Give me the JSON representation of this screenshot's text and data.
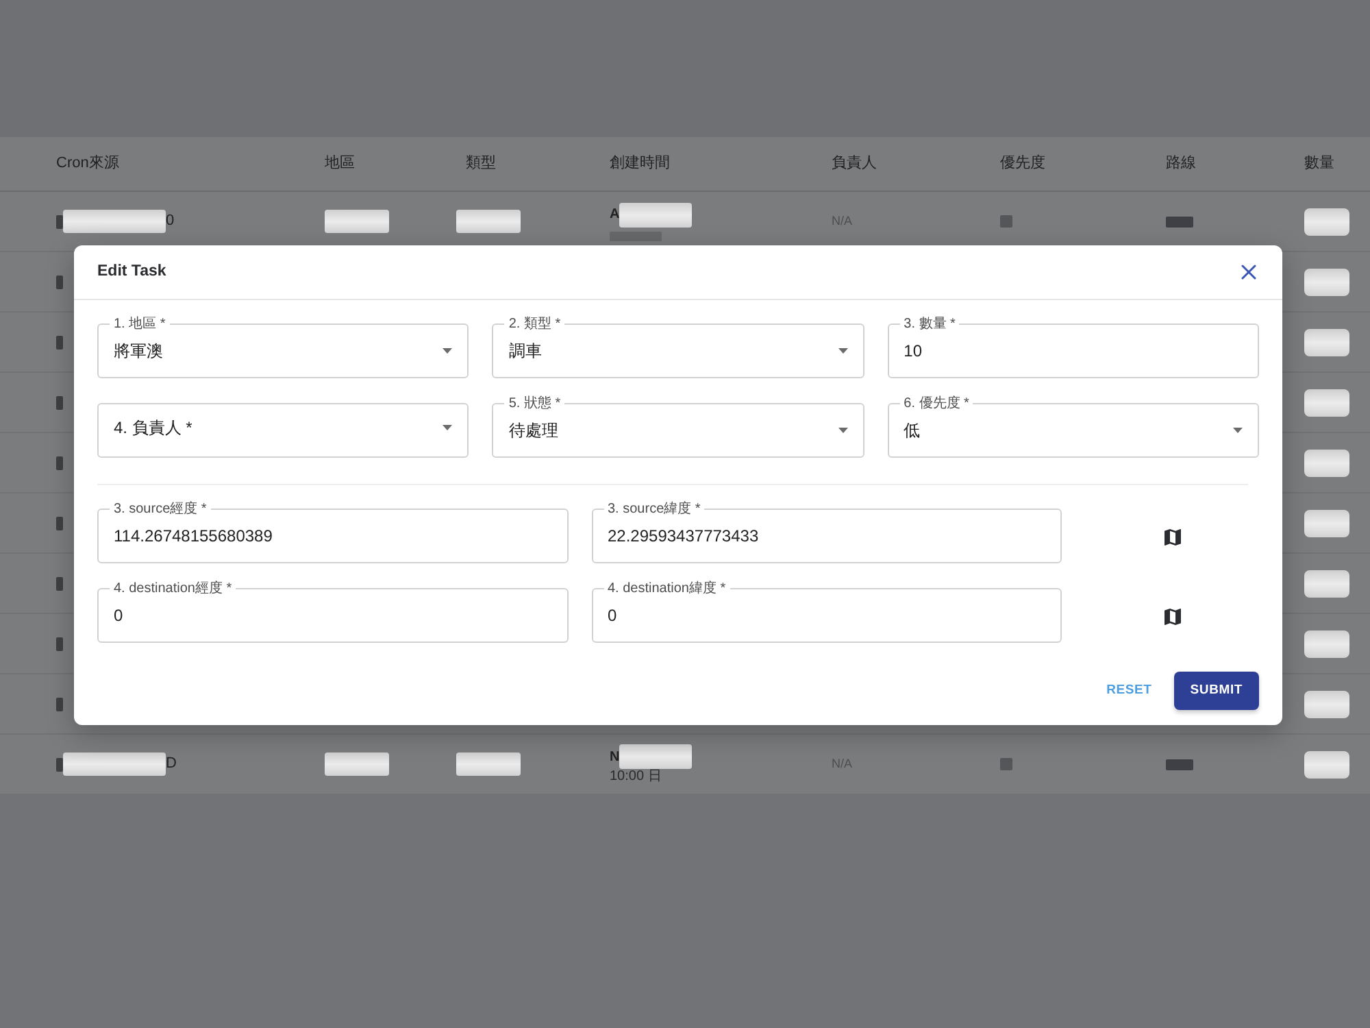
{
  "background_table": {
    "columns": [
      "Cron來源",
      "地區",
      "類型",
      "創建時間",
      "負責人",
      "優先度",
      "路線",
      "數量"
    ],
    "rows": [
      {
        "cron_source": [
          [
            {
              "kind": "blur"
            },
            {
              "kind": "redacted"
            },
            {
              "kind": "text",
              "text": "0"
            }
          ]
        ],
        "region": [
          [
            {
              "kind": "redacted"
            }
          ]
        ],
        "type": [
          [
            {
              "kind": "redacted"
            }
          ]
        ],
        "created_at": [
          [
            {
              "kind": "text",
              "text": "A"
            },
            {
              "kind": "redacted"
            }
          ],
          [
            {
              "kind": "blur"
            }
          ]
        ],
        "owner": [
          [
            {
              "kind": "text",
              "text": "N/A"
            }
          ]
        ],
        "priority": [
          [
            {
              "kind": "blur"
            }
          ]
        ],
        "route": [
          [
            {
              "kind": "blur"
            }
          ]
        ],
        "quantity": [
          [
            {
              "kind": "redacted"
            }
          ]
        ]
      },
      {
        "cron_source": [
          [
            {
              "kind": "blur"
            }
          ]
        ],
        "quantity": [
          [
            {
              "kind": "redacted"
            }
          ]
        ]
      },
      {
        "cron_source": [
          [
            {
              "kind": "blur"
            }
          ]
        ],
        "quantity": [
          [
            {
              "kind": "redacted"
            }
          ]
        ]
      },
      {
        "cron_source": [
          [
            {
              "kind": "blur"
            }
          ]
        ],
        "quantity": [
          [
            {
              "kind": "redacted"
            }
          ]
        ]
      },
      {
        "cron_source": [
          [
            {
              "kind": "blur"
            }
          ]
        ],
        "quantity": [
          [
            {
              "kind": "redacted"
            }
          ]
        ]
      },
      {
        "cron_source": [
          [
            {
              "kind": "blur"
            }
          ]
        ],
        "quantity": [
          [
            {
              "kind": "redacted"
            }
          ]
        ]
      },
      {
        "cron_source": [
          [
            {
              "kind": "blur"
            }
          ]
        ],
        "quantity": [
          [
            {
              "kind": "redacted"
            }
          ]
        ]
      },
      {
        "cron_source": [
          [
            {
              "kind": "blur"
            }
          ]
        ],
        "quantity": [
          [
            {
              "kind": "redacted"
            }
          ]
        ]
      },
      {
        "cron_source": [
          [
            {
              "kind": "blur"
            }
          ]
        ],
        "quantity": [
          [
            {
              "kind": "redacted"
            }
          ]
        ]
      },
      {
        "cron_source": [
          [
            {
              "kind": "blur"
            },
            {
              "kind": "redacted"
            },
            {
              "kind": "text",
              "text": "D"
            }
          ]
        ],
        "region": [
          [
            {
              "kind": "redacted"
            }
          ]
        ],
        "type": [
          [
            {
              "kind": "redacted"
            }
          ]
        ],
        "created_at": [
          [
            {
              "kind": "text",
              "text": "N"
            },
            {
              "kind": "redacted"
            }
          ],
          [
            {
              "kind": "text",
              "text": "10:00 日"
            }
          ]
        ],
        "owner": [
          [
            {
              "kind": "text",
              "text": "N/A"
            }
          ]
        ],
        "priority": [
          [
            {
              "kind": "blur"
            }
          ]
        ],
        "route": [
          [
            {
              "kind": "blur"
            }
          ]
        ],
        "quantity": [
          [
            {
              "kind": "redacted"
            }
          ]
        ]
      }
    ]
  },
  "dialog": {
    "title": "Edit Task",
    "fields": [
      {
        "kind": "select",
        "label": "1. 地區 *",
        "value": "將軍澳"
      },
      {
        "kind": "select",
        "label": "2. 類型 *",
        "value": "調車"
      },
      {
        "kind": "text",
        "label": "3. 數量 *",
        "value": "10"
      },
      {
        "kind": "select",
        "label": "4. 負責人 *"
      },
      {
        "kind": "select",
        "label": "5. 狀態 *",
        "value": "待處理"
      },
      {
        "kind": "select",
        "label": "6. 優先度 *",
        "value": "低"
      }
    ],
    "coordinates": [
      {
        "fields": [
          {
            "label": "3. source經度 *",
            "value": "114.26748155680389"
          },
          {
            "label": "3. source緯度 *",
            "value": "22.29593437773433"
          }
        ]
      },
      {
        "fields": [
          {
            "label": "4. destination經度 *",
            "value": "0"
          },
          {
            "label": "4. destination緯度 *",
            "value": "0"
          }
        ]
      }
    ],
    "buttons": [
      {
        "kind": "text",
        "label": "RESET"
      },
      {
        "kind": "contained",
        "label": "SUBMIT"
      }
    ]
  }
}
